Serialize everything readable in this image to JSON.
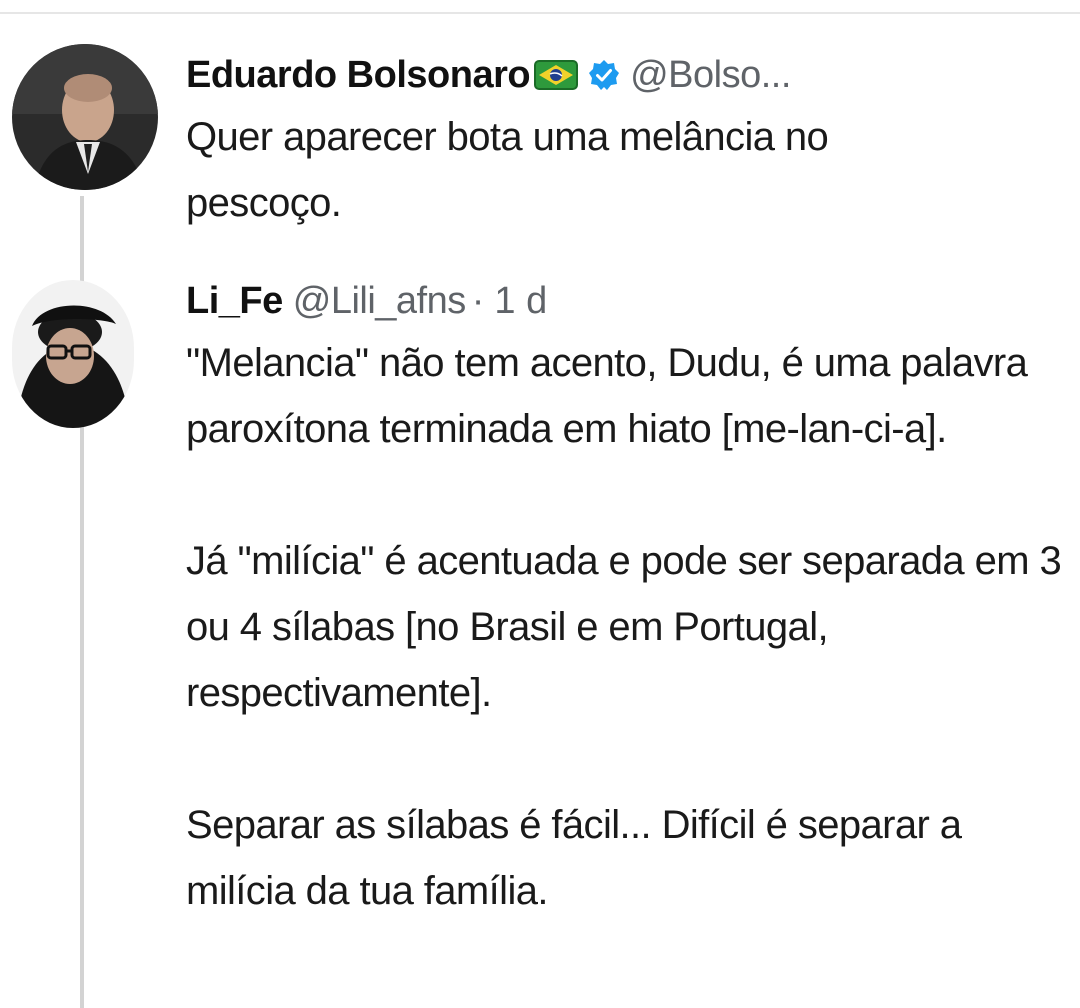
{
  "original_tweet": {
    "display_name": "Eduardo Bolsonaro",
    "flag_icon": "brazil-flag-icon",
    "verified_icon": "verified-badge-icon",
    "handle": "@Bolso...",
    "text": "Quer aparecer bota uma melância no pescoço."
  },
  "reply_tweet": {
    "display_name": "Li_Fe",
    "handle": "@Lili_afns",
    "separator": "·",
    "time": "1 d",
    "paragraphs": [
      "\"Melancia\" não tem acento, Dudu, é uma palavra paroxítona terminada em hiato [me-lan-ci-a].",
      "Já \"milícia\" é acentuada e pode ser separada em 3 ou 4 sílabas [no Brasil e em Portugal, respectivamente].",
      "Separar as sílabas é fácil... Difícil é separar a milícia da tua família."
    ]
  },
  "colors": {
    "text": "#1a1a1a",
    "secondary": "#5f6368",
    "verified": "#1d9bf0",
    "thread_line": "#d3d3d3"
  }
}
